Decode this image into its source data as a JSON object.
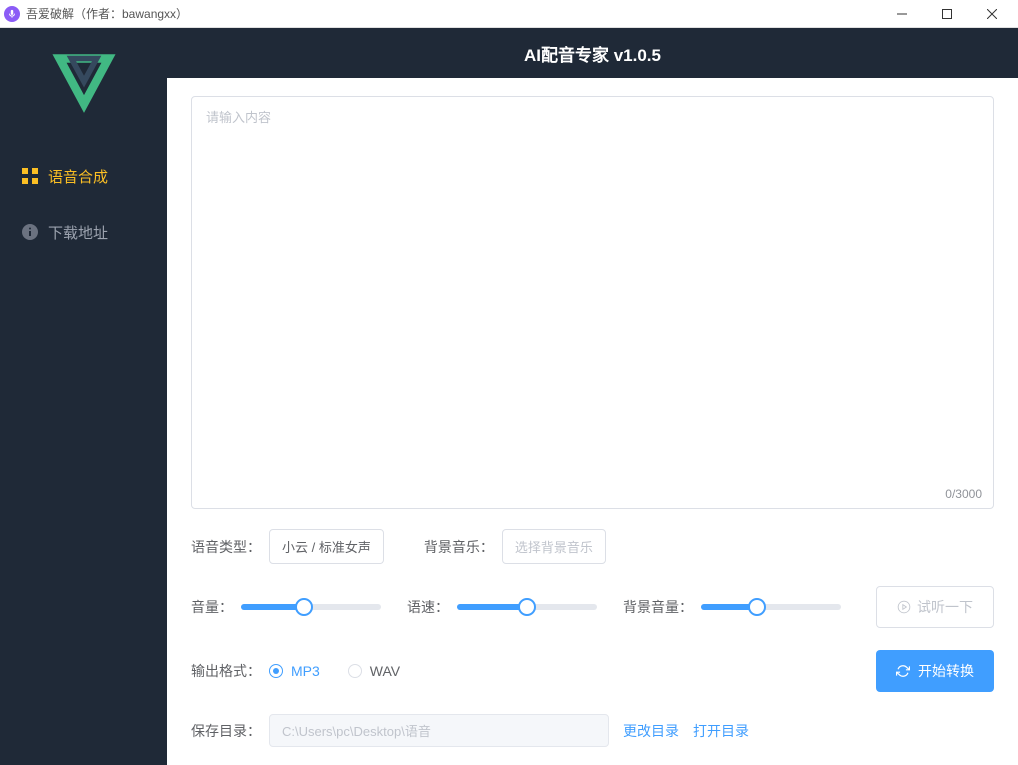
{
  "titlebar": {
    "text": "吾爱破解（作者：bawangxx）"
  },
  "sidebar": {
    "items": [
      {
        "label": "语音合成",
        "active": true
      },
      {
        "label": "下载地址",
        "active": false
      }
    ]
  },
  "header": {
    "title": "AI配音专家 v1.0.5"
  },
  "textarea": {
    "placeholder": "请输入内容",
    "charCount": "0/3000"
  },
  "voiceType": {
    "label": "语音类型：",
    "value": "小云 / 标准女声"
  },
  "bgMusic": {
    "label": "背景音乐：",
    "placeholder": "选择背景音乐"
  },
  "sliders": {
    "volume": {
      "label": "音量：",
      "percent": 45
    },
    "speed": {
      "label": "语速：",
      "percent": 50
    },
    "bgVolume": {
      "label": "背景音量：",
      "percent": 40
    }
  },
  "preview": {
    "label": "试听一下"
  },
  "format": {
    "label": "输出格式：",
    "options": [
      {
        "label": "MP3",
        "checked": true
      },
      {
        "label": "WAV",
        "checked": false
      }
    ]
  },
  "convert": {
    "label": "开始转换"
  },
  "savePath": {
    "label": "保存目录：",
    "value": "C:\\Users\\pc\\Desktop\\语音",
    "changeLabel": "更改目录",
    "openLabel": "打开目录"
  }
}
